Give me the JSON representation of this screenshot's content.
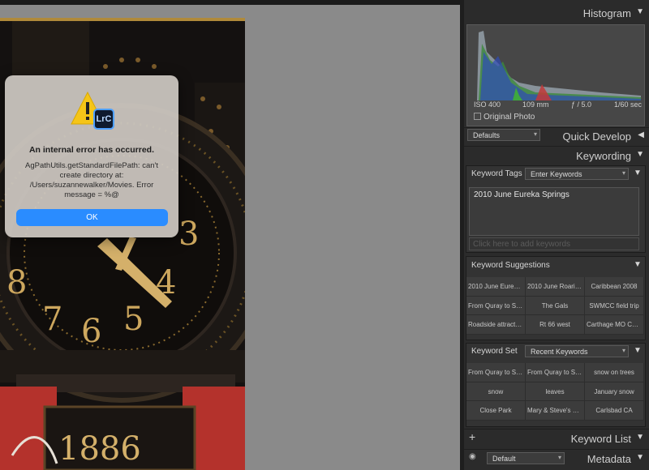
{
  "dialog": {
    "title": "An internal error has occurred.",
    "message": "AgPathUtils.getStandardFilePath: can't create directory at: /Users/suzannewalker/Movies. Error message = %@",
    "ok_label": "OK",
    "app_badge": "LrC"
  },
  "photo": {
    "year": "1886",
    "numerals": [
      "8",
      "7",
      "6",
      "5",
      "4",
      "3"
    ]
  },
  "panels": {
    "histogram": {
      "title": "Histogram",
      "stats": {
        "iso": "ISO 400",
        "focal": "109 mm",
        "aperture": "ƒ / 5.0",
        "shutter": "1/60 sec"
      },
      "original_photo_label": "Original Photo"
    },
    "quick_develop": {
      "title": "Quick Develop",
      "preset": "Defaults"
    },
    "keywording": {
      "title": "Keywording",
      "tags_label": "Keyword Tags",
      "tags_mode": "Enter Keywords",
      "keywords": "2010 June Eureka Springs",
      "input_placeholder": "Click here to add keywords",
      "suggestions_label": "Keyword Suggestions",
      "suggestions": [
        "2010 June Eureka S...",
        "2010 June Roaring...",
        "Caribbean 2008",
        "From Quray to Silv...",
        "The Gals",
        "SWMCC field trip",
        "Roadside attraction",
        "Rt 66 west",
        "Carthage MO Cour..."
      ],
      "set_label": "Keyword Set",
      "set_value": "Recent Keywords",
      "set_keywords": [
        "From Quray to Silv...",
        "From Quray to Silv...",
        "snow on trees",
        "snow",
        "leaves",
        "January snow",
        "Close Park",
        "Mary & Steve's ho...",
        "Carlsbad CA"
      ]
    },
    "keyword_list": {
      "title": "Keyword List"
    },
    "metadata": {
      "title": "Metadata",
      "preset": "Default"
    }
  },
  "colors": {
    "accent": "#2a8cff",
    "panel_bg": "#2b2b2b",
    "viewer_bg": "#8a8a8a"
  }
}
